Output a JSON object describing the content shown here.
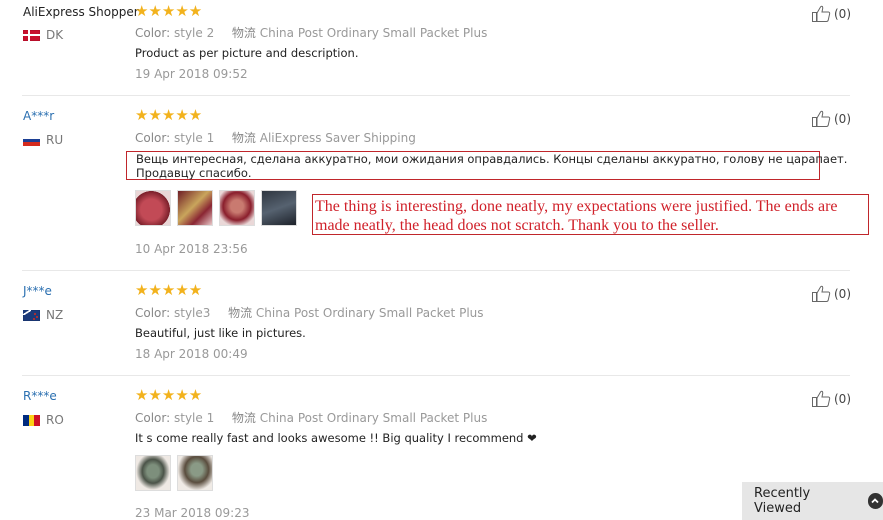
{
  "reviews": [
    {
      "user": "AliExpress Shopper",
      "country": "DK",
      "stars": "★★★★★",
      "color_label": "Color:",
      "color_value": "style 2",
      "logistics_label": "物流",
      "logistics_value": "China Post Ordinary Small Packet Plus",
      "text": "Product as per picture and description.",
      "date": "19 Apr 2018 09:52",
      "helpful": "(0)"
    },
    {
      "user": "A***r",
      "country": "RU",
      "stars": "★★★★★",
      "color_label": "Color:",
      "color_value": "style 1",
      "logistics_label": "物流",
      "logistics_value": "AliExpress Saver Shipping",
      "text_line1": "Вещь интересная, сделана аккуратно, мои ожидания оправдались. Концы сделаны аккуратно, голову не царапает.",
      "text_line2": "Продавцу спасибо.",
      "translation": "The thing is interesting, done neatly, my expectations were justified. The ends are made neatly, the head does not scratch. Thank you to the seller.",
      "date": "10 Apr 2018 23:56",
      "helpful": "(0)"
    },
    {
      "user": "J***e",
      "country": "NZ",
      "stars": "★★★★★",
      "color_label": "Color:",
      "color_value": "style3",
      "logistics_label": "物流",
      "logistics_value": "China Post Ordinary Small Packet Plus",
      "text": "Beautiful, just like in pictures.",
      "date": "18 Apr 2018 00:49",
      "helpful": "(0)"
    },
    {
      "user": "R***e",
      "country": "RO",
      "stars": "★★★★★",
      "color_label": "Color:",
      "color_value": "style 1",
      "logistics_label": "物流",
      "logistics_value": "China Post Ordinary Small Packet Plus",
      "text": "It s come really fast and looks awesome !! Big quality I recommend ❤",
      "date": "23 Mar 2018 09:23",
      "helpful": "(0)"
    }
  ],
  "recently_viewed": {
    "label": "Recently Viewed",
    "icon": "chevron-up-icon"
  },
  "colors": {
    "star": "#f2b21d",
    "link": "#2a6fb0",
    "highlight": "#c0262b"
  }
}
